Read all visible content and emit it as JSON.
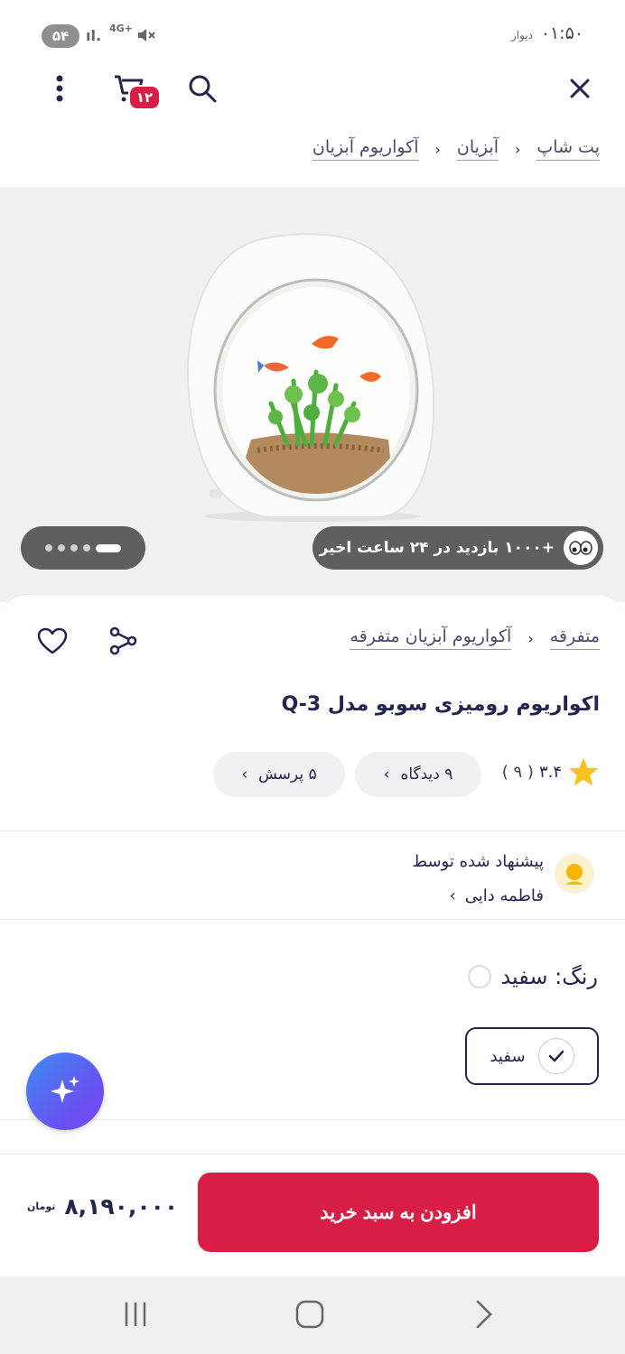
{
  "status_bar": {
    "time": "۰۱:۵۰",
    "carrier": "دیوار",
    "battery": "۵۴",
    "network": "4G+"
  },
  "cart": {
    "count": "۱۲"
  },
  "breadcrumbs": [
    "پت شاپ",
    "آبزیان",
    "آکواریوم آبزیان"
  ],
  "gallery": {
    "views_text": "+۱۰۰۰ بازدید در ۲۴ ساعت اخیر",
    "image_count": 5,
    "active_index": 0
  },
  "product": {
    "category_crumbs": [
      "متفرقه",
      "آکواریوم آبزیان متفرقه"
    ],
    "title": "اکواریوم رومیزی سوبو مدل Q-3",
    "rating": "۳.۴",
    "rating_count": "( ۹ )",
    "reviews_chip": "۹ دیدگاه",
    "questions_chip": "۵ پرسش"
  },
  "suggested": {
    "label": "پیشنهاد شده توسط",
    "name": "فاطمه دایی"
  },
  "color": {
    "label": "رنگ: سفید",
    "selected_variant": "سفید",
    "swatch_color": "#ffffff"
  },
  "buy": {
    "button_label": "افزودن به سبد خرید",
    "price": "۸,۱۹۰,۰۰۰",
    "currency": "تومان"
  },
  "colors": {
    "accent": "#d91e45",
    "text": "#23254e",
    "pill_bg": "#5f5f5f"
  }
}
